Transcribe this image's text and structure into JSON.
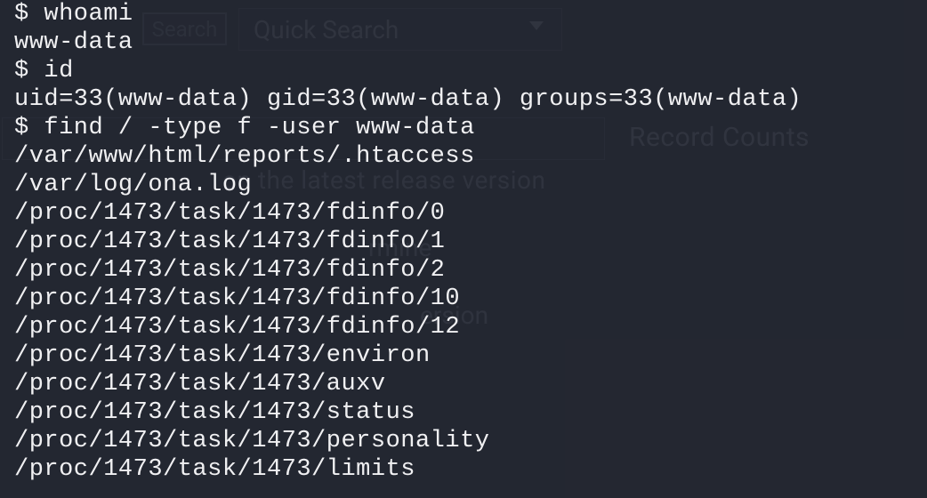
{
  "bg_ui": {
    "search_button": "Search",
    "quick_search_placeholder": "Quick Search",
    "record_counts": "Record Counts",
    "release_text": "on the latest release version",
    "mine_fragment": "rmine",
    "version_fragment": "ersion"
  },
  "terminal": {
    "lines": [
      {
        "prompt": "$ ",
        "text": "whoami"
      },
      {
        "prompt": "",
        "text": "www-data"
      },
      {
        "prompt": "$ ",
        "text": "id"
      },
      {
        "prompt": "",
        "text": "uid=33(www-data) gid=33(www-data) groups=33(www-data)"
      },
      {
        "prompt": "$ ",
        "text": "find / -type f -user www-data"
      },
      {
        "prompt": "",
        "text": "/var/www/html/reports/.htaccess"
      },
      {
        "prompt": "",
        "text": "/var/log/ona.log"
      },
      {
        "prompt": "",
        "text": "/proc/1473/task/1473/fdinfo/0"
      },
      {
        "prompt": "",
        "text": "/proc/1473/task/1473/fdinfo/1"
      },
      {
        "prompt": "",
        "text": "/proc/1473/task/1473/fdinfo/2"
      },
      {
        "prompt": "",
        "text": "/proc/1473/task/1473/fdinfo/10"
      },
      {
        "prompt": "",
        "text": "/proc/1473/task/1473/fdinfo/12"
      },
      {
        "prompt": "",
        "text": "/proc/1473/task/1473/environ"
      },
      {
        "prompt": "",
        "text": "/proc/1473/task/1473/auxv"
      },
      {
        "prompt": "",
        "text": "/proc/1473/task/1473/status"
      },
      {
        "prompt": "",
        "text": "/proc/1473/task/1473/personality"
      },
      {
        "prompt": "",
        "text": "/proc/1473/task/1473/limits"
      }
    ]
  }
}
